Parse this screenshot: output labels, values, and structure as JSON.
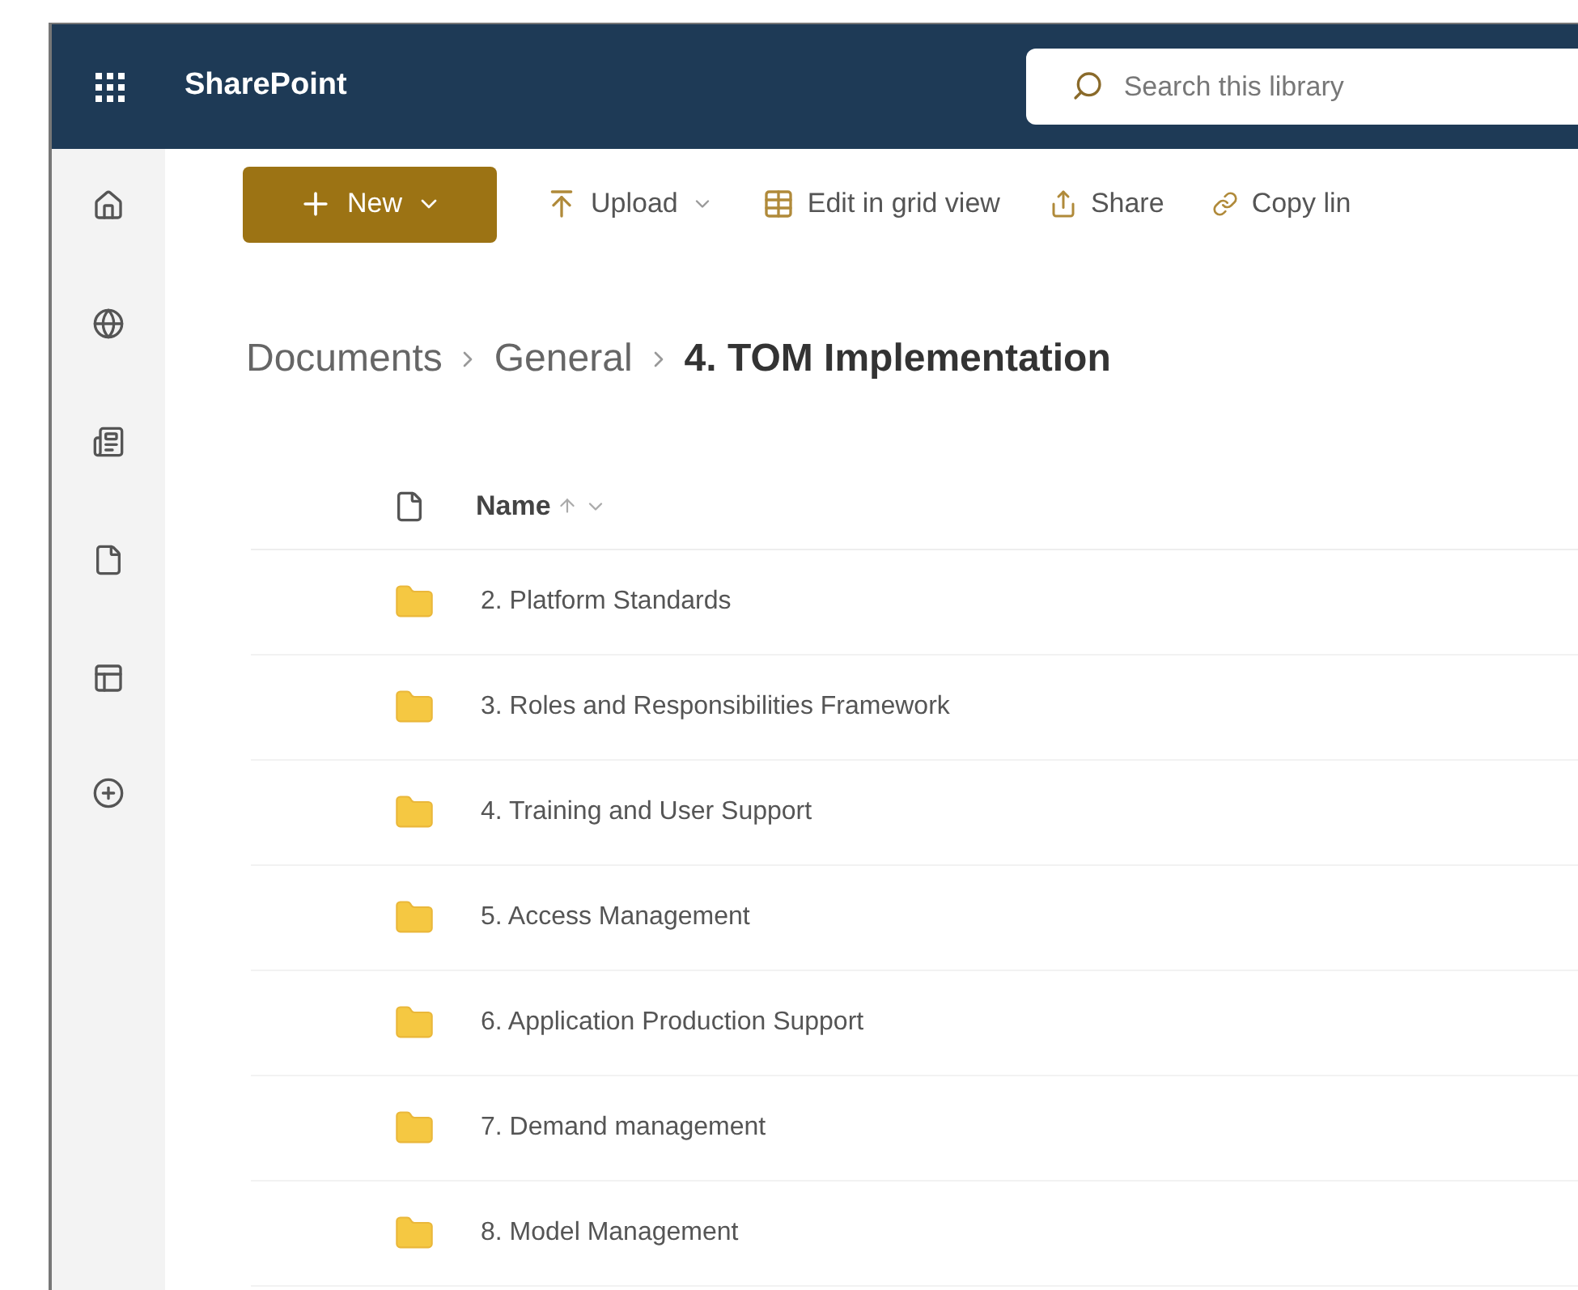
{
  "app": {
    "title": "SharePoint"
  },
  "search": {
    "placeholder": "Search this library"
  },
  "commands": [
    {
      "kind": "new",
      "label": "New"
    },
    {
      "kind": "upload",
      "label": "Upload"
    },
    {
      "kind": "grid",
      "label": "Edit in grid view"
    },
    {
      "kind": "share",
      "label": "Share"
    },
    {
      "kind": "link",
      "label": "Copy lin"
    }
  ],
  "breadcrumb": [
    {
      "label": "Documents",
      "current": false
    },
    {
      "label": "General",
      "current": false
    },
    {
      "label": "4. TOM Implementation",
      "current": true
    }
  ],
  "table": {
    "columns": [
      {
        "label": "Name"
      }
    ],
    "rows": [
      {
        "name": "2. Platform Standards"
      },
      {
        "name": "3. Roles and Responsibilities Framework"
      },
      {
        "name": "4. Training and User Support"
      },
      {
        "name": "5. Access Management"
      },
      {
        "name": "6. Application Production Support"
      },
      {
        "name": "7. Demand management"
      },
      {
        "name": "8. Model Management"
      }
    ]
  }
}
